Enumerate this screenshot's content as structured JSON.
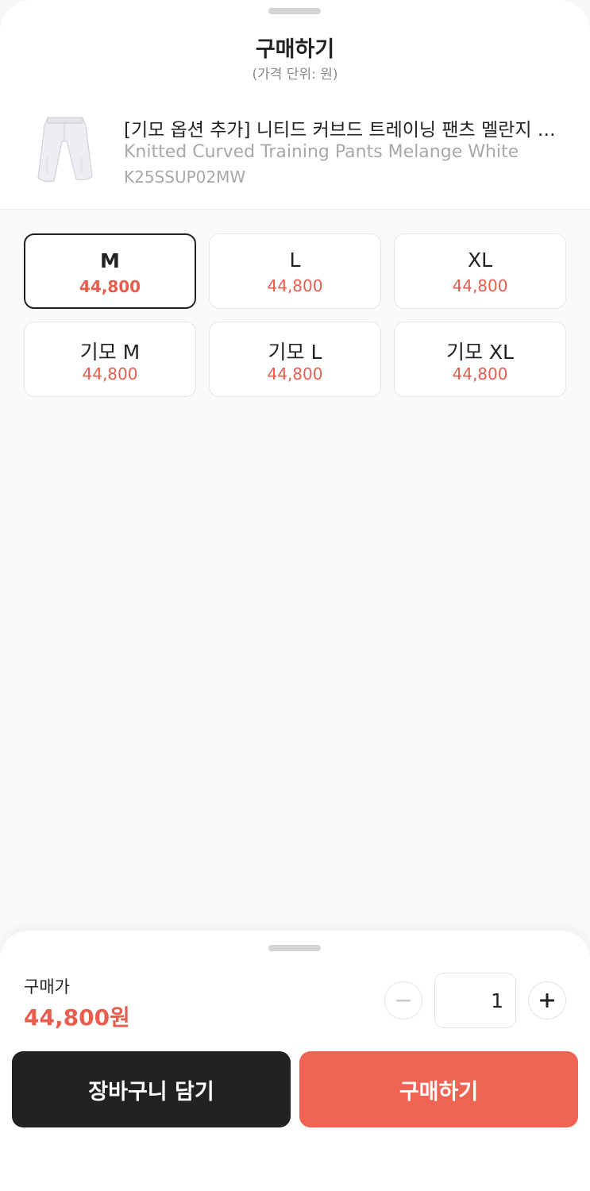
{
  "header": {
    "title": "구매하기",
    "subtitle": "(가격 단위: 원)"
  },
  "product": {
    "name": "[기모 옵션 추가] 니티드 커브드 트레이닝 팬츠 멜란지 화이트",
    "name_en": "Knitted Curved Training Pants Melange White",
    "code": "K25SSUP02MW",
    "thumbnail_icon": "pants-thumbnail"
  },
  "options": [
    {
      "label": "M",
      "price": "44,800",
      "selected": true
    },
    {
      "label": "L",
      "price": "44,800",
      "selected": false
    },
    {
      "label": "XL",
      "price": "44,800",
      "selected": false
    },
    {
      "label": "기모 M",
      "price": "44,800",
      "selected": false
    },
    {
      "label": "기모 L",
      "price": "44,800",
      "selected": false
    },
    {
      "label": "기모 XL",
      "price": "44,800",
      "selected": false
    }
  ],
  "footer": {
    "total_label": "구매가",
    "total_price": "44,800원",
    "quantity": "1",
    "minus_icon": "minus-icon",
    "plus_icon": "plus-icon",
    "cart_label": "장바구니 담기",
    "buy_label": "구매하기"
  },
  "colors": {
    "accent": "#EE6352",
    "price": "#E85D4E",
    "dark_button": "#222222"
  }
}
